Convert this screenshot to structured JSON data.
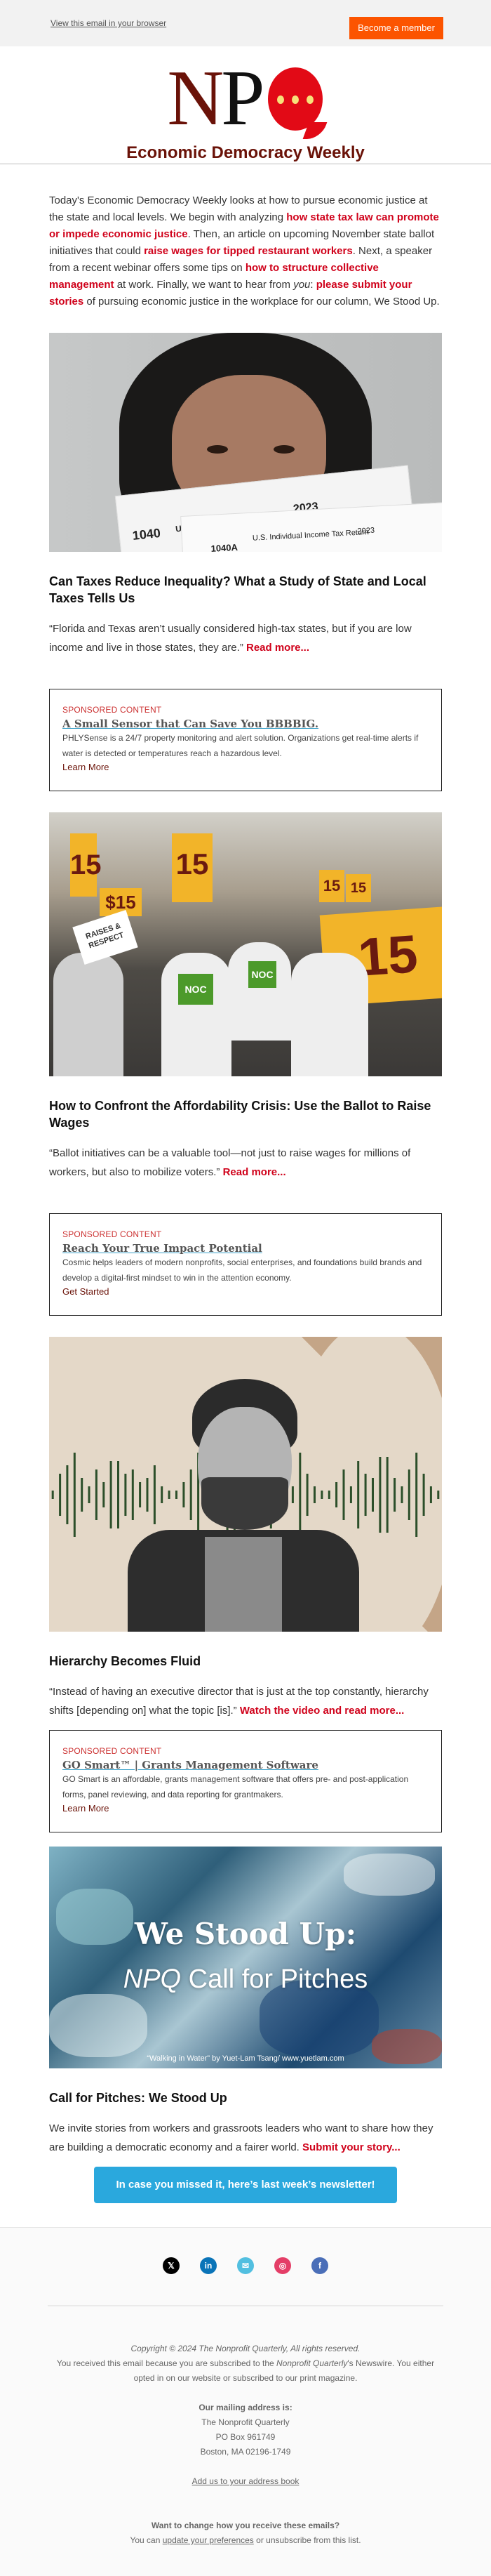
{
  "preheader": {
    "view_in_browser": "View this email in your browser",
    "become_member": "Become a member",
    "member_button_color": "#fc5400"
  },
  "masthead": {
    "logo_letters": [
      "N",
      "P",
      "Q"
    ],
    "newsletter_title": "Economic Democracy Weekly",
    "brand_color": "#6a1208",
    "accent_color": "#e20a16"
  },
  "intro": {
    "p1": "Today's Economic Democracy Weekly looks at how to pursue economic justice at the state and local levels. We begin with analyzing ",
    "link1": "how state tax law can promote or impede economic justice",
    "p2": ". Then, an article on upcoming November state ballot initiatives that could ",
    "link2": "raise wages for tipped restaurant workers",
    "p3": ". Next, a speaker from a recent webinar offers some tips on ",
    "link3": "how to structure collective management",
    "p4": " at work. Finally, we want to hear from ",
    "you": "you",
    "p5": ": ",
    "link4": "please submit your stories",
    "p6": " of pursuing economic justice in the workplace for our column, We Stood Up."
  },
  "articles": [
    {
      "image_alt": "Woman holding 1040 tax forms over her face",
      "image_text": [
        "1040",
        "U.S. Individual Income Tax Return",
        "2023",
        "1040A",
        "U.S. Individual Income Tax Return",
        "2023"
      ],
      "title": "Can Taxes Reduce Inequality? What a Study of State and Local Taxes Tells Us",
      "quote": "“Florida and Texas aren’t usually considered high-tax states, but if you are low income and live in those states, they are.” ",
      "link": "Read more..."
    },
    {
      "image_alt": "Workers marching with $15 signs",
      "image_text": [
        "15",
        "$15",
        "15",
        "15",
        "15",
        "15",
        "RAISES & RESPECT",
        "NOC"
      ],
      "title": "How to Confront the Affordability Crisis: Use the Ballot to Raise Wages",
      "quote": "“Ballot initiatives can be a valuable tool—not just to raise wages for millions of workers, but also to mobilize voters.” ",
      "link": "Read more..."
    },
    {
      "image_alt": "Portrait of a speaker in front of an audio waveform",
      "title": "Hierarchy Becomes Fluid",
      "quote": "“Instead of having an executive director that is just at the top constantly, hierarchy shifts [depending on] what the topic [is].” ",
      "link": "Watch the video and read more..."
    },
    {
      "image_alt": "Abstract blue painting with We Stood Up text",
      "image_title": "We Stood Up:",
      "image_sub_italic": "NPQ",
      "image_sub": " Call for Pitches",
      "image_credit": "“Walking in Water” by Yuet-Lam Tsang/ www.yuetlam.com",
      "title": "Call for Pitches: We Stood Up",
      "quote": "We invite stories from workers and grassroots leaders who want to share how they are building a democratic economy and a fairer world. ",
      "link": "Submit your story..."
    }
  ],
  "ads": [
    {
      "label": "SPONSORED CONTENT",
      "headline": "A Small Sensor that Can Save You BBBBIG.",
      "description": "PHLYSense is a 24/7 property monitoring and alert solution. Organizations get real-time alerts if water is detected or temperatures reach a hazardous level.",
      "cta": "Learn More"
    },
    {
      "label": "SPONSORED CONTENT",
      "headline": "Reach Your True Impact Potential",
      "description": "Cosmic helps leaders of modern nonprofits, social enterprises, and foundations build brands and develop a digital-first mindset to win in the attention economy.",
      "cta": "Get Started"
    },
    {
      "label": "SPONSORED CONTENT",
      "headline": "GO Smart™ | Grants Management Software",
      "description": "GO Smart is an affordable, grants management software that offers pre- and post-application forms, panel reviewing, and data reporting for grantmakers.",
      "cta": "Learn More"
    }
  ],
  "newsletter_button": "In case you missed it, here’s last week’s newsletter!",
  "social": [
    {
      "name": "x",
      "glyph": "𝕏",
      "color": "#000000"
    },
    {
      "name": "linkedin",
      "glyph": "in",
      "color": "#0a74b8"
    },
    {
      "name": "email",
      "glyph": "✉",
      "color": "#52bfe0"
    },
    {
      "name": "instagram",
      "glyph": "◎",
      "color": "#e43e67"
    },
    {
      "name": "facebook",
      "glyph": "f",
      "color": "#4a6eb8"
    }
  ],
  "footer": {
    "copyright": "Copyright © 2024 The Nonprofit Quarterly, All rights reserved.",
    "received_1": "You received this email because you are subscribed to the ",
    "received_italic": "Nonprofit Quarterly",
    "received_2": "'s Newswire. You either opted in on our website or subscribed to our print magazine.",
    "mailing_heading": "Our mailing address is:",
    "address": [
      "The Nonprofit Quarterly",
      "PO Box 961749",
      "Boston, MA 02196-1749"
    ],
    "address_book": "Add us to your address book",
    "change_heading": "Want to change how you receive these emails?",
    "change_1": "You can ",
    "update_link": "update your preferences",
    "change_2": " or unsubscribe from this list."
  }
}
